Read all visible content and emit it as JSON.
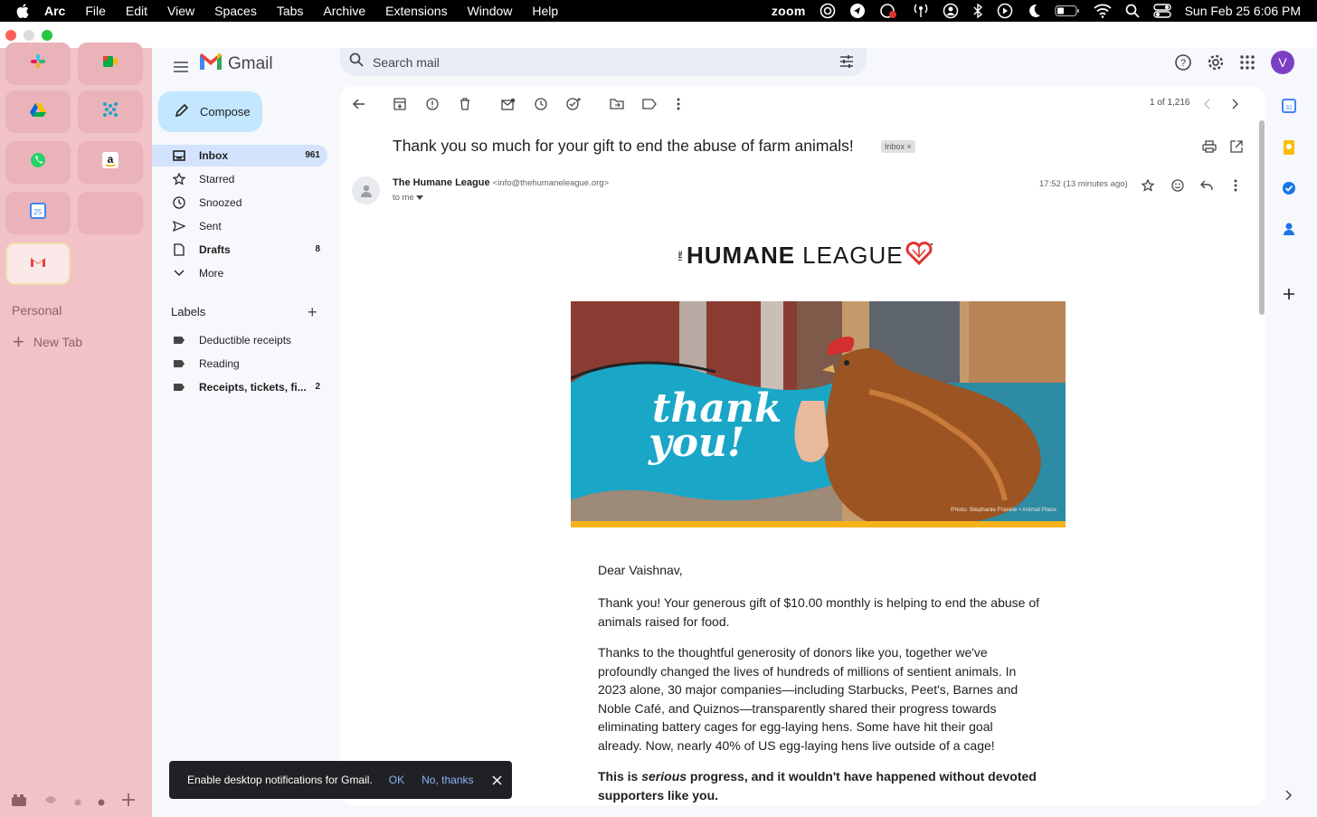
{
  "menubar": {
    "app": "Arc",
    "items": [
      "File",
      "Edit",
      "View",
      "Spaces",
      "Tabs",
      "Archive",
      "Extensions",
      "Window",
      "Help"
    ],
    "zoom_label": "zoom",
    "datetime": "Sun Feb 25  6:06 PM"
  },
  "arc": {
    "section": "Personal",
    "new_tab": "New Tab"
  },
  "gmail": {
    "logo_text": "Gmail",
    "search_placeholder": "Search mail",
    "avatar_initial": "V",
    "compose": "Compose",
    "nav": [
      {
        "label": "Inbox",
        "count": "961"
      },
      {
        "label": "Starred",
        "count": ""
      },
      {
        "label": "Snoozed",
        "count": ""
      },
      {
        "label": "Sent",
        "count": ""
      },
      {
        "label": "Drafts",
        "count": "8"
      },
      {
        "label": "More",
        "count": ""
      }
    ],
    "labels_title": "Labels",
    "labels": [
      {
        "label": "Deductible receipts",
        "count": ""
      },
      {
        "label": "Reading",
        "count": ""
      },
      {
        "label": "Receipts, tickets, fi...",
        "count": "2"
      }
    ]
  },
  "email": {
    "pager": "1 of 1,216",
    "subject": "Thank you so much for your gift to end the abuse of farm animals!",
    "chip": "Inbox",
    "sender_name": "The Humane League",
    "sender_addr": "<info@thehumaneleague.org>",
    "to": "to me",
    "time": "17:52 (13 minutes ago)",
    "logo_the": "THE",
    "logo_w1": "HUMANE",
    "logo_w2": "LEAGUE",
    "hero_line1": "thank",
    "hero_line2": "you!",
    "hero_credit": "Photo: Stephanie Frankle  •  Animal Place",
    "greeting": "Dear Vaishnav,",
    "p1": "Thank you! Your generous gift of $10.00 monthly is helping to end the abuse of animals raised for food.",
    "p2": "Thanks to the thoughtful generosity of donors like you, together we've profoundly changed the lives of hundreds of millions of sentient animals. In 2023 alone, 30 major companies—including Starbucks, Peet's, Barnes and Noble Café, and Quiznos—transparently shared their progress towards eliminating battery cages for egg-laying hens. Some have hit their goal already. Now, nearly 40% of US egg-laying hens live outside of a cage!",
    "p3_a": "This is ",
    "p3_b": "serious",
    "p3_c": " progress, and it wouldn't have happened without devoted supporters like you."
  },
  "snackbar": {
    "message": "Enable desktop notifications for Gmail.",
    "ok": "OK",
    "no": "No, thanks"
  },
  "colors": {
    "arc_bg": "#f1c3c8",
    "gmail_bg": "#f6f8fc",
    "compose": "#c2e7ff",
    "nav_active": "#d3e3fd",
    "accent_blue": "#8ab4f8",
    "hero_teal": "#1aa6c6",
    "hero_yellow": "#f6b21b",
    "humane_red": "#e2332f"
  }
}
